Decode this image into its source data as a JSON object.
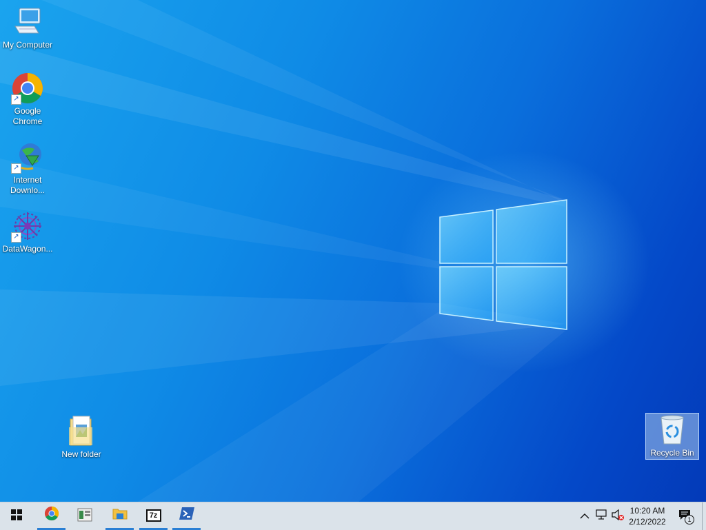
{
  "desktop": {
    "icons": [
      {
        "label": "My Computer",
        "icon": "computer-icon"
      },
      {
        "label": "Google\nChrome",
        "icon": "chrome-icon",
        "shortcut": true
      },
      {
        "label": "Internet\nDownlo...",
        "icon": "internet-download-manager-icon",
        "shortcut": true
      },
      {
        "label": "DataWagon...",
        "icon": "datawagon-icon",
        "shortcut": true
      },
      {
        "label": "New folder",
        "icon": "folder-icon"
      },
      {
        "label": "Recycle Bin",
        "icon": "recycle-bin-icon",
        "selected": true
      }
    ]
  },
  "taskbar": {
    "start": {
      "icon": "windows-start-icon"
    },
    "pinned": [
      {
        "name": "Google Chrome",
        "icon": "chrome-icon",
        "running": true
      },
      {
        "name": "Server Manager",
        "icon": "server-manager-icon",
        "running": false
      },
      {
        "name": "File Explorer",
        "icon": "file-explorer-icon",
        "running": true
      },
      {
        "name": "7-Zip",
        "icon": "7zip-icon",
        "label": "7z",
        "running": true
      },
      {
        "name": "PowerShell",
        "icon": "powershell-icon",
        "running": true
      }
    ],
    "tray": {
      "icons": [
        "chevron-up-icon",
        "network-icon",
        "volume-muted-icon"
      ],
      "time": "10:20 AM",
      "date": "2/12/2022",
      "notifications": {
        "icon": "action-center-icon",
        "count": "1"
      }
    }
  },
  "colors": {
    "accent": "#2a7fd4",
    "taskbar": "#dbe3ea",
    "desktop_start": "#1aa4ee",
    "desktop_end": "#033ab8"
  }
}
